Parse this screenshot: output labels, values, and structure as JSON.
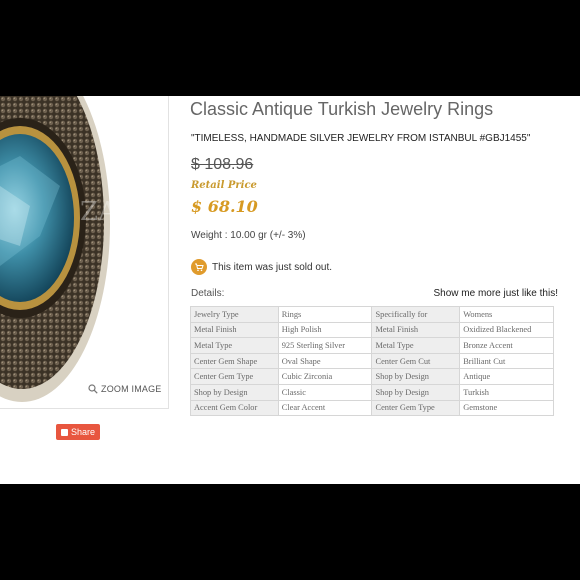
{
  "product": {
    "title": "Classic Antique Turkish Jewelry Rings",
    "subtitle": "\"TIMELESS, HANDMADE SILVER JEWELRY FROM ISTANBUL #GBJ1455\"",
    "old_price": "$ 108.96",
    "retail_label": "Retail Price",
    "price": "$ 68.10",
    "weight": "Weight : 10.00 gr (+/- 3%)",
    "sold_text": "This item was just sold out.",
    "watermark": "ZAR"
  },
  "image_panel": {
    "zoom_label": "ZOOM IMAGE",
    "share_label": "Share"
  },
  "details": {
    "label": "Details:",
    "show_more": "Show me more just like this!",
    "rows": [
      [
        "Jewelry Type",
        "Rings",
        "Specifically for",
        "Womens"
      ],
      [
        "Metal Finish",
        "High Polish",
        "Metal Finish",
        "Oxidized Blackened"
      ],
      [
        "Metal Type",
        "925 Sterling Silver",
        "Metal Type",
        "Bronze Accent"
      ],
      [
        "Center Gem Shape",
        "Oval Shape",
        "Center Gem Cut",
        "Brilliant Cut"
      ],
      [
        "Center Gem Type",
        "Cubic Zirconia",
        "Shop by Design",
        "Antique"
      ],
      [
        "Shop by Design",
        "Classic",
        "Shop by Design",
        "Turkish"
      ],
      [
        "Accent Gem Color",
        "Clear Accent",
        "Center Gem Type",
        "Gemstone"
      ]
    ]
  },
  "colors": {
    "price_gold": "#d79a22",
    "share_red": "#e8563f",
    "cart_orange": "#e09b2c"
  },
  "icons": [
    "zoom-icon",
    "cart-icon",
    "share-icon"
  ]
}
